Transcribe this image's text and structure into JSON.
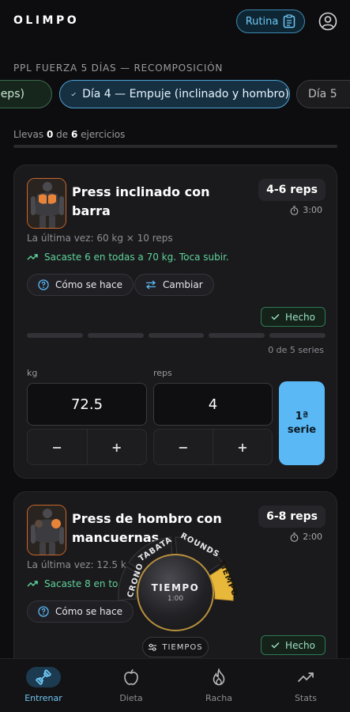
{
  "header": {
    "logo": "OLIMPO",
    "routine_button": "Rutina",
    "user_icon": "user-circle-icon"
  },
  "program": {
    "title": "PPL FUERZA 5 DÍAS — RECOMPOSICIÓN",
    "tabs": [
      {
        "label": "ceps)",
        "state": "completed"
      },
      {
        "label": "Día 4 — Empuje (inclinado y hombro)",
        "state": "active"
      },
      {
        "label": "Día 5",
        "state": "upcoming"
      }
    ]
  },
  "progress": {
    "prefix": "Llevas",
    "done": "0",
    "middle": "de",
    "total": "6",
    "suffix": "ejercicios",
    "fraction": 0
  },
  "exercises": [
    {
      "name": "Press inclinado con barra",
      "reps": "4-6 reps",
      "rest": "3:00",
      "last_time": "La última vez: 60 kg × 10 reps",
      "hint": "Sacaste 6 en todas a 70 kg. Toca subir.",
      "how_label": "Cómo se hace",
      "swap_label": "Cambiar",
      "done_label": "Hecho",
      "series_done": 0,
      "series_total": 5,
      "series_text": "0 de 5 series",
      "kg_label": "kg",
      "kg_value": "72.5",
      "reps_label": "reps",
      "reps_value": "4",
      "minus": "−",
      "plus": "+",
      "serie_line1": "1ª",
      "serie_line2": "serie"
    },
    {
      "name_line1": "Press de hombro con",
      "name_line2": "mancuernas",
      "reps": "6-8 reps",
      "rest": "2:00",
      "last_time": "La última vez: 12.5 k",
      "hint": "Sacaste 8 en to",
      "how_label": "Cómo se hace",
      "done_label": "Hecho"
    }
  ],
  "timer": {
    "modes": [
      "CRONO",
      "TABATA",
      "ROUNDS",
      "TIEMPO"
    ],
    "active_mode": "TIEMPO",
    "title": "TIEMPO",
    "time": "1:00",
    "menu_label": "TIEMPOS"
  },
  "nav": {
    "items": [
      {
        "label": "Entrenar",
        "icon": "dumbbell-icon",
        "active": true
      },
      {
        "label": "Dieta",
        "icon": "apple-icon",
        "active": false
      },
      {
        "label": "Racha",
        "icon": "flame-icon",
        "active": false
      },
      {
        "label": "Stats",
        "icon": "trend-up-icon",
        "active": false
      }
    ]
  },
  "colors": {
    "accent": "#5ab8f5",
    "success": "#5fd39a",
    "timer_gold": "#e8b83a",
    "muscle_highlight": "#e8843a"
  }
}
